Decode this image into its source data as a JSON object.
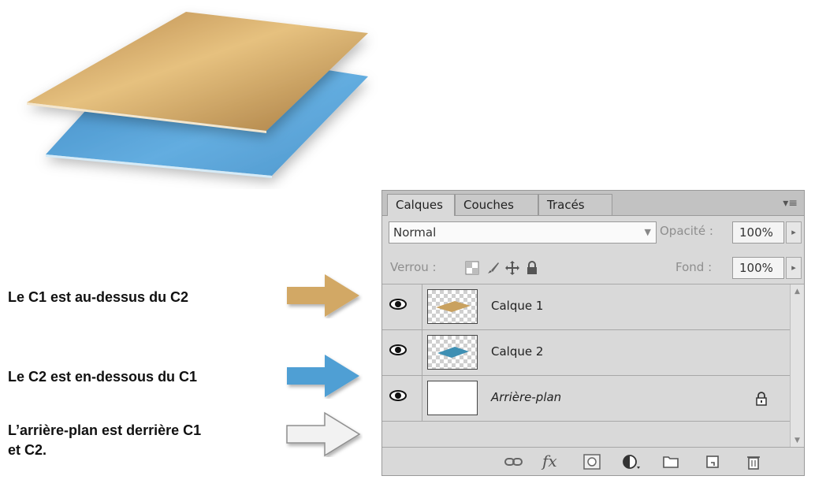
{
  "captions": {
    "c1": "Le C1 est au-dessus du C2",
    "c2": "Le C2 est en-dessous du  C1",
    "bg_line1": "L’arrière-plan est derrière C1",
    "bg_line2": "et C2."
  },
  "colors": {
    "gold": "#d4ac67",
    "blue": "#4f9fd4",
    "arrow_gray": "#e8e8e8",
    "panel_bg": "#d9d9d9"
  },
  "panel": {
    "tabs": [
      {
        "label": "Calques",
        "active": true
      },
      {
        "label": "Couches",
        "active": false
      },
      {
        "label": "Tracés",
        "active": false
      }
    ],
    "menu_icon": "panel-menu-icon",
    "blend_mode": "Normal",
    "opacity_label": "Opacité :",
    "opacity_value": "100%",
    "lock_label": "Verrou :",
    "fill_label": "Fond :",
    "fill_value": "100%",
    "layers": [
      {
        "name": "Calque 1",
        "visible": true,
        "thumb": "gold-sheet"
      },
      {
        "name": "Calque 2",
        "visible": true,
        "thumb": "blue-sheet"
      },
      {
        "name": "Arrière-plan",
        "visible": true,
        "thumb": "white",
        "locked": true
      }
    ],
    "footer_icons": [
      "link-icon",
      "fx-icon",
      "mask-icon",
      "adjustment-icon",
      "folder-icon",
      "new-layer-icon",
      "trash-icon"
    ],
    "fx_text": "fx"
  }
}
